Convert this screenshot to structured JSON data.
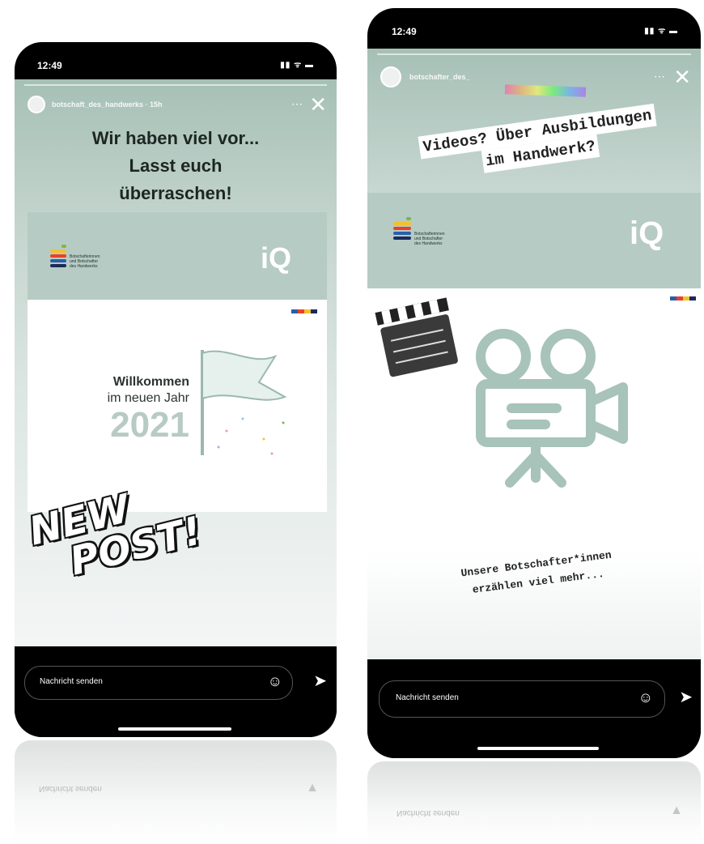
{
  "phones": [
    {
      "time": "12:49",
      "signal": "▮▮ ᯤ ▬",
      "account": "botschaft_des_handwerks · 15h",
      "headline": [
        "Wir haben viel vor...",
        "Lasst euch",
        "überraschen!"
      ],
      "card": {
        "logo_text": [
          "Botschafterinnen",
          "und Botschafter",
          "des Handwerks"
        ],
        "iq_label": "iQ",
        "welcome_lines": [
          "Willkommen",
          "im neuen Jahr"
        ],
        "year": "2021"
      },
      "sticker": [
        "NEW",
        "POST!"
      ],
      "message_placeholder": "Nachricht senden",
      "reflection_text": "Nachricht senden"
    },
    {
      "time": "12:49",
      "signal": "▮▮ ᯤ ▬",
      "account": "botschafter_des_",
      "headline": [
        "Videos? Über Ausbildungen",
        "im Handwerk?"
      ],
      "card": {
        "logo_text": [
          "Botschafterinnen",
          "und Botschafter",
          "des Handwerks"
        ],
        "iq_label": "iQ"
      },
      "caption": [
        "Unsere Botschafter*innen",
        "erzählen viel mehr..."
      ],
      "message_placeholder": "Nachricht senden",
      "reflection_text": "Nachricht senden"
    }
  ],
  "colors": {
    "story_bg_top": "#a9c2b9",
    "story_bg_bottom": "#f2f5f4",
    "accent_green": "#8fb0a5",
    "logo_bars": [
      "#7bb843",
      "#f2c12e",
      "#e8412a",
      "#2b5ea8",
      "#1b2a5a"
    ]
  }
}
